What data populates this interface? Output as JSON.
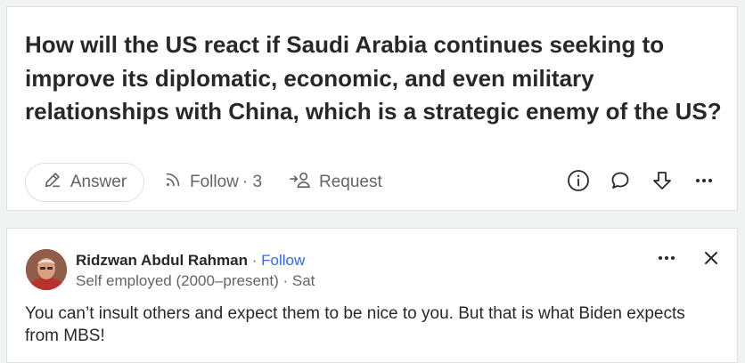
{
  "question": {
    "title": "How will the US react if Saudi Arabia continues seeking to improve its diplomatic, economic, and even military relationships with China, which is a strategic enemy of the US?",
    "answer_label": "Answer",
    "follow_label": "Follow",
    "follow_count": "· 3",
    "request_label": "Request"
  },
  "answer": {
    "author_name": "Ridzwan Abdul Rahman",
    "separator": " · ",
    "follow_label": "Follow",
    "credential": "Self employed (2000–present) · Sat",
    "text": "You can’t insult others and expect them to be nice to you. But that is what Biden expects from MBS!"
  },
  "icons": {
    "answer": "pencil-icon",
    "follow": "follow-signal-icon",
    "request": "request-person-icon",
    "info": "info-icon",
    "comment": "comment-icon",
    "downvote": "downvote-icon",
    "more": "more-dots-icon",
    "close": "close-icon"
  },
  "colors": {
    "background": "#f1f2f2",
    "card": "#ffffff",
    "text": "#282829",
    "muted": "#636466",
    "link": "#2e69ff"
  }
}
